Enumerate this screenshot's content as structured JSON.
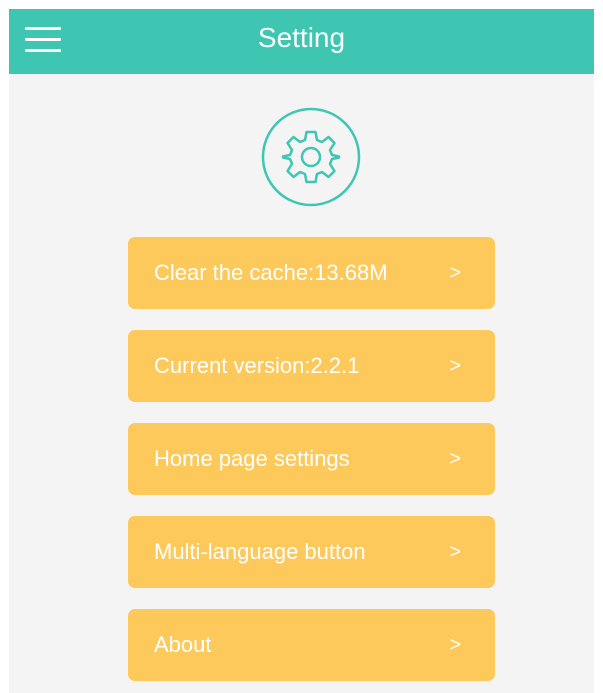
{
  "header": {
    "title": "Setting"
  },
  "icons": {
    "menu": "hamburger-menu-icon",
    "gear": "gear-icon",
    "chevron": "chevron-right-icon"
  },
  "colors": {
    "header": "#3ec6b3",
    "gear": "#3ec6b3",
    "item_background": "#fdc95a",
    "text": "#ffffff",
    "page_background": "#f4f4f4"
  },
  "menu": {
    "items": [
      {
        "label": "Clear the cache:13.68M",
        "chevron": ">"
      },
      {
        "label": "Current version:2.2.1",
        "chevron": ">"
      },
      {
        "label": "Home page settings",
        "chevron": ">"
      },
      {
        "label": "Multi-language button",
        "chevron": ">"
      },
      {
        "label": "About",
        "chevron": ">"
      }
    ]
  }
}
